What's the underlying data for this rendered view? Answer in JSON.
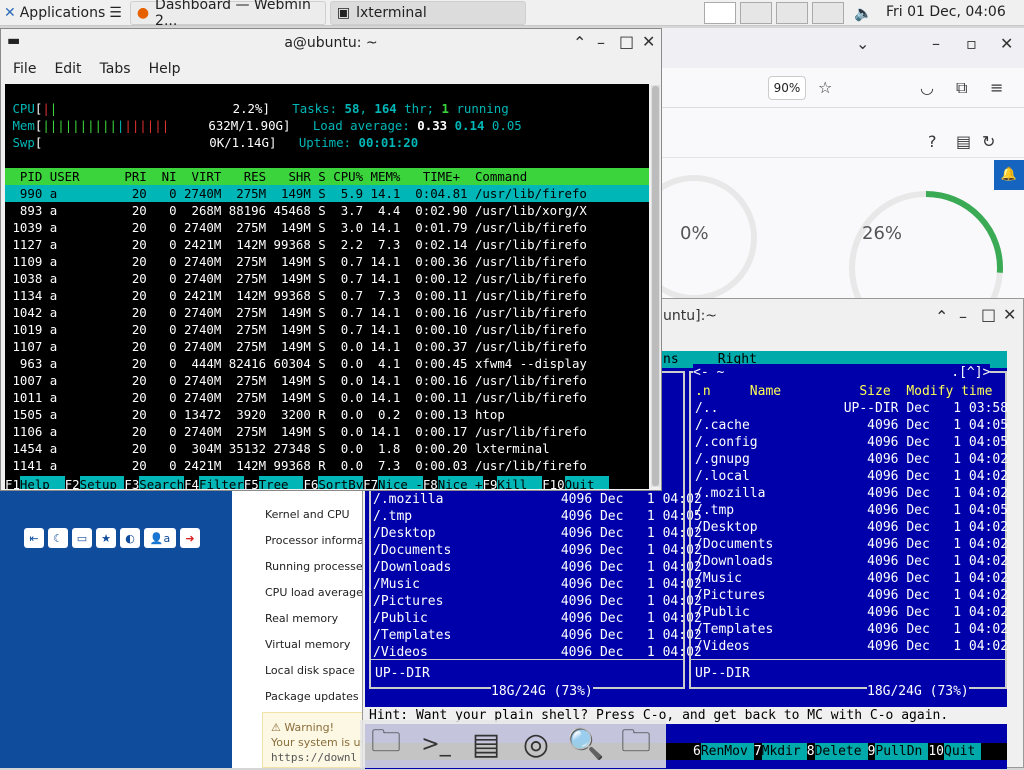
{
  "panel": {
    "apps_label": "Applications",
    "tasks": [
      {
        "label": "Dashboard — Webmin 2..."
      },
      {
        "label": "lxterminal"
      }
    ],
    "clock": "Fri 01 Dec, 04:06"
  },
  "firefox": {
    "zoom": "90%",
    "gauge_1": "0%",
    "gauge_2": "26%",
    "gauge_2_value": 0.26
  },
  "webmin": {
    "menu": [
      "Kernel and CPU",
      "Processor informa",
      "Running processes",
      "CPU load averages",
      "Real memory",
      "Virtual memory",
      "Local disk space",
      "Package updates"
    ],
    "warning_title": "Warning!",
    "warning_text": "Your system is us",
    "warning_link": "https://downl",
    "user_badge": "a"
  },
  "mc": {
    "title": "untu]:~",
    "menu_tail": "ns     Right",
    "left_rows": [
      "/.mozilla               4096 Dec   1 04:02",
      "/.tmp                   4096 Dec   1 04:05",
      "/Desktop                4096 Dec   1 04:02",
      "/Documents              4096 Dec   1 04:02",
      "/Downloads              4096 Dec   1 04:02",
      "/Music                  4096 Dec   1 04:02",
      "/Pictures               4096 Dec   1 04:02",
      "/Public                 4096 Dec   1 04:02",
      "/Templates              4096 Dec   1 04:02",
      "/Videos                 4096 Dec   1 04:02"
    ],
    "right_header": "<- ~                             .[^]>",
    "right_cols": ".n     Name          Size  Modify time",
    "right_rows": [
      "/..                UP--DIR Dec   1 03:58",
      "/.cache               4096 Dec   1 04:05",
      "/.config              4096 Dec   1 04:05",
      "/.gnupg               4096 Dec   1 04:02",
      "/.local               4096 Dec   1 04:02",
      "/.mozilla             4096 Dec   1 04:02",
      "/.tmp                 4096 Dec   1 04:05",
      "/Desktop              4096 Dec   1 04:02",
      "/Documents            4096 Dec   1 04:02",
      "/Downloads            4096 Dec   1 04:02",
      "/Music                4096 Dec   1 04:02",
      "/Pictures             4096 Dec   1 04:02",
      "/Public               4096 Dec   1 04:02",
      "/Templates            4096 Dec   1 04:02",
      "/Videos               4096 Dec   1 04:02"
    ],
    "left_status": "UP--DIR",
    "right_status": "UP--DIR",
    "left_free": "18G/24G (73%)",
    "right_free": "18G/24G (73%)",
    "hint": "Hint: Want your plain shell? Press C-o, and get back to MC with C-o again.",
    "fkeys": [
      {
        "n": "6",
        "l": "RenMov"
      },
      {
        "n": "7",
        "l": "Mkdir"
      },
      {
        "n": "8",
        "l": "Delete"
      },
      {
        "n": "9",
        "l": "PullDn"
      },
      {
        "n": "10",
        "l": "Quit"
      }
    ]
  },
  "lxterminal": {
    "title": "a@ubuntu: ~",
    "menu": [
      "File",
      "Edit",
      "Tabs",
      "Help"
    ],
    "htop": {
      "cpu": "2.2%",
      "mem": "632M/1.90G",
      "swp": "0K/1.14G",
      "tasks_count": "58",
      "threads": "164",
      "running": "1",
      "load1": "0.33",
      "load5": "0.14",
      "load15": "0.05",
      "uptime": "00:01:20",
      "header": "  PID USER      PRI  NI  VIRT   RES   SHR S CPU% MEM%   TIME+  Command",
      "rows": [
        {
          "t": "  990 a          20   0 2740M  275M  149M S  5.9 14.1  0:04.81 /usr/lib/firefo",
          "sel": true
        },
        {
          "t": "  893 a          20   0  268M 88196 45468 S  3.7  4.4  0:02.90 /usr/lib/xorg/X"
        },
        {
          "t": " 1039 a          20   0 2740M  275M  149M S  3.0 14.1  0:01.79 /usr/lib/firefo"
        },
        {
          "t": " 1127 a          20   0 2421M  142M 99368 S  2.2  7.3  0:02.14 /usr/lib/firefo"
        },
        {
          "t": " 1109 a          20   0 2740M  275M  149M S  0.7 14.1  0:00.36 /usr/lib/firefo"
        },
        {
          "t": " 1038 a          20   0 2740M  275M  149M S  0.7 14.1  0:00.12 /usr/lib/firefo"
        },
        {
          "t": " 1134 a          20   0 2421M  142M 99368 S  0.7  7.3  0:00.11 /usr/lib/firefo"
        },
        {
          "t": " 1042 a          20   0 2740M  275M  149M S  0.7 14.1  0:00.16 /usr/lib/firefo"
        },
        {
          "t": " 1019 a          20   0 2740M  275M  149M S  0.7 14.1  0:00.10 /usr/lib/firefo"
        },
        {
          "t": " 1107 a          20   0 2740M  275M  149M S  0.0 14.1  0:00.37 /usr/lib/firefo"
        },
        {
          "t": "  963 a          20   0  444M 82416 60304 S  0.0  4.1  0:00.45 xfwm4 --display"
        },
        {
          "t": " 1007 a          20   0 2740M  275M  149M S  0.0 14.1  0:00.16 /usr/lib/firefo"
        },
        {
          "t": " 1011 a          20   0 2740M  275M  149M S  0.0 14.1  0:00.11 /usr/lib/firefo"
        },
        {
          "t": " 1505 a          20   0 13472  3920  3200 R  0.0  0.2  0:00.13 htop"
        },
        {
          "t": " 1106 a          20   0 2740M  275M  149M S  0.0 14.1  0:00.17 /usr/lib/firefo"
        },
        {
          "t": " 1454 a          20   0  304M 35132 27348 S  0.0  1.8  0:00.20 lxterminal"
        },
        {
          "t": " 1141 a          20   0 2421M  142M 99368 R  0.0  7.3  0:00.03 /usr/lib/firefo"
        }
      ],
      "fkeys": [
        {
          "n": "F1",
          "l": "Help  "
        },
        {
          "n": "F2",
          "l": "Setup "
        },
        {
          "n": "F3",
          "l": "Search"
        },
        {
          "n": "F4",
          "l": "Filter"
        },
        {
          "n": "F5",
          "l": "Tree  "
        },
        {
          "n": "F6",
          "l": "SortBy"
        },
        {
          "n": "F7",
          "l": "Nice -"
        },
        {
          "n": "F8",
          "l": "Nice +"
        },
        {
          "n": "F9",
          "l": "Kill  "
        },
        {
          "n": "F10",
          "l": "Quit  "
        }
      ]
    }
  }
}
